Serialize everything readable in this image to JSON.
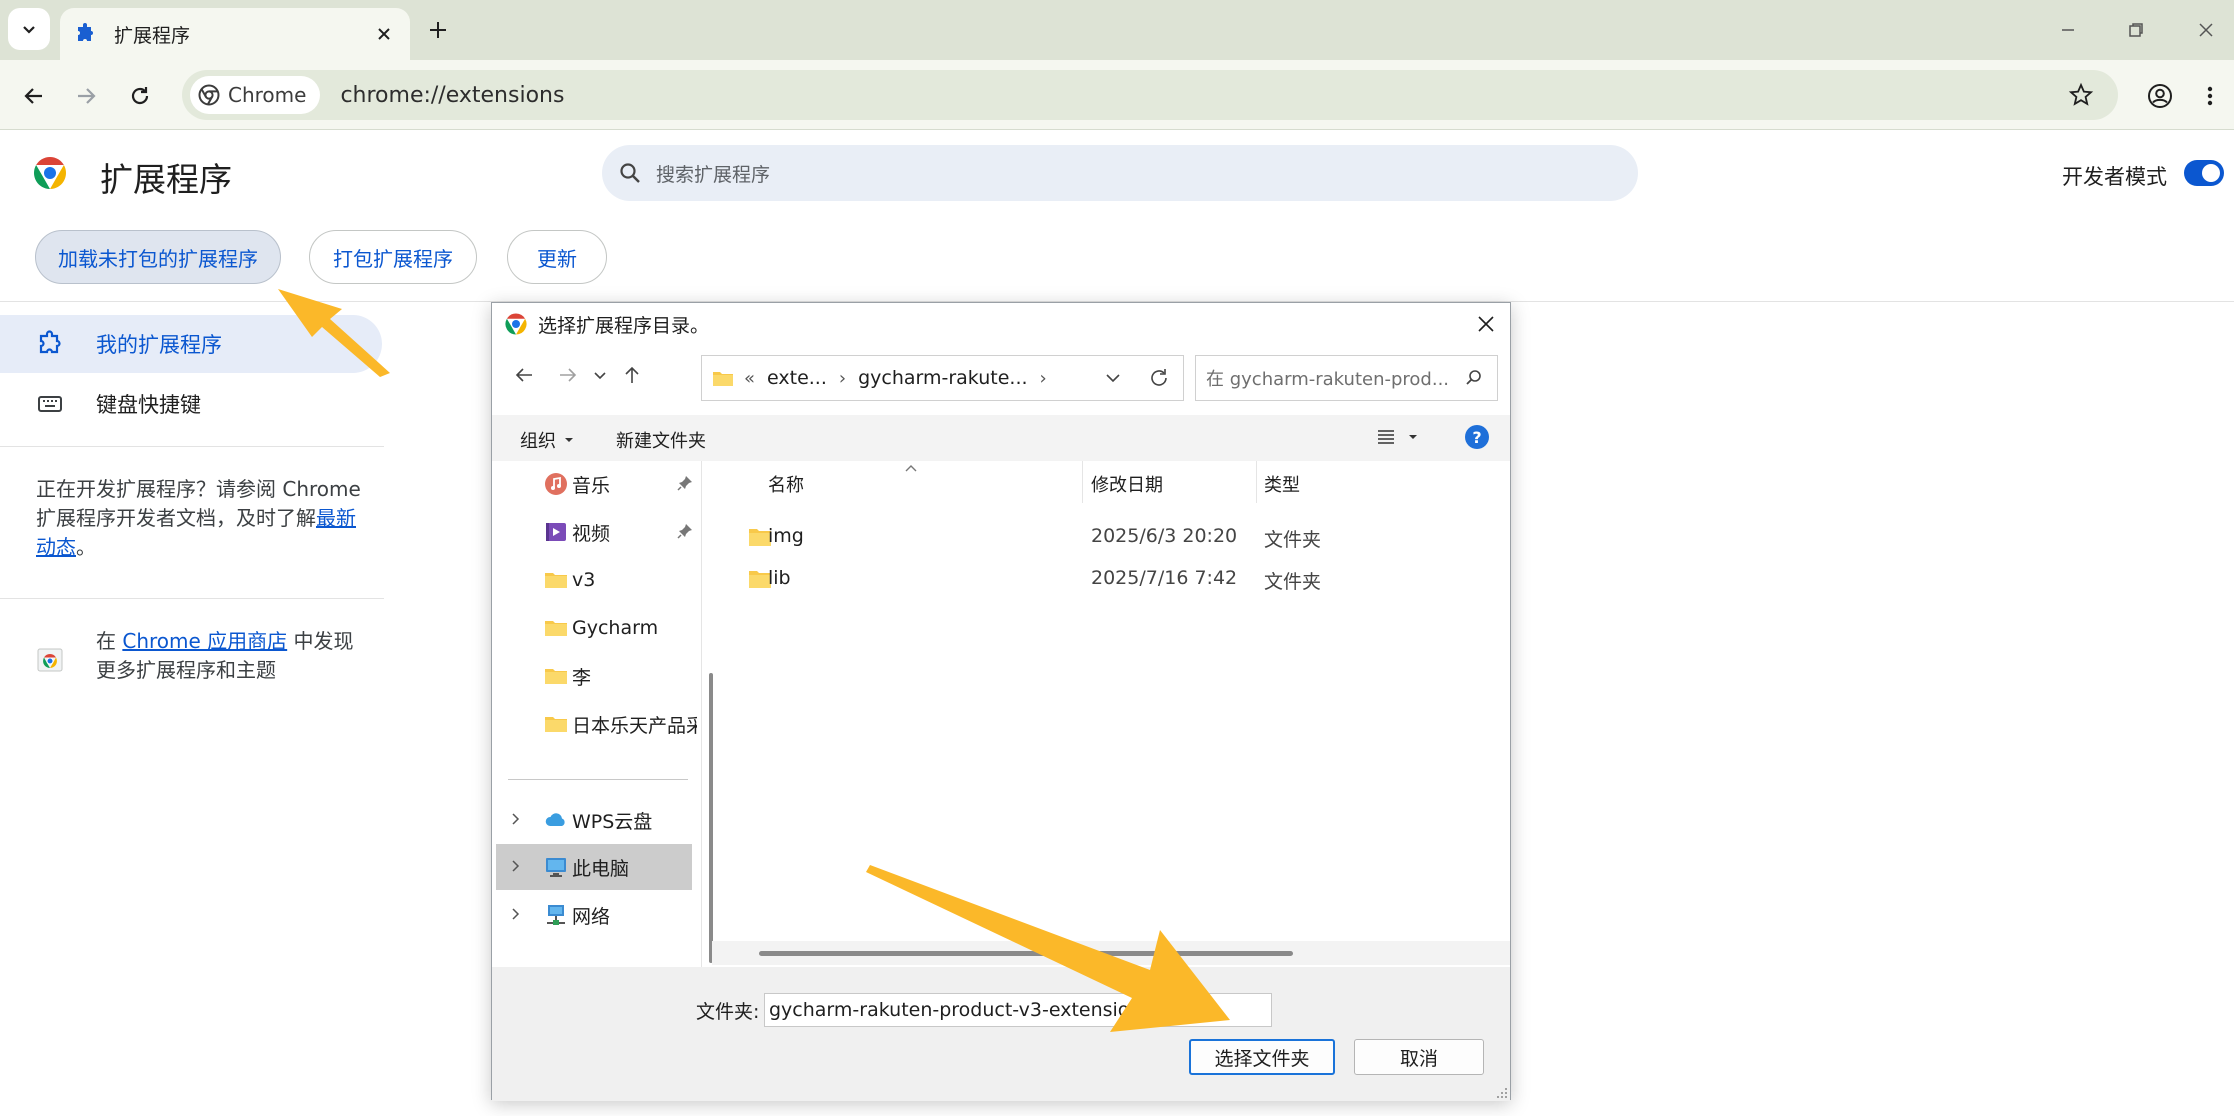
{
  "browser": {
    "tab_title": "扩展程序",
    "chip_label": "Chrome",
    "url": "chrome://extensions"
  },
  "page": {
    "title": "扩展程序",
    "search_placeholder": "搜索扩展程序",
    "dev_mode_label": "开发者模式",
    "dev_mode_on": true,
    "buttons": {
      "load_unpacked": "加载未打包的扩展程序",
      "pack": "打包扩展程序",
      "update": "更新"
    },
    "sidebar": {
      "my_extensions": "我的扩展程序",
      "shortcuts": "键盘快捷键",
      "dev_text_1": "正在开发扩展程序？请参阅 Chrome 扩展程序开发者文档，及时了解",
      "dev_link": "最新动态",
      "dev_text_2": "。",
      "store_text_1": "在",
      "store_link": "Chrome 应用商店",
      "store_text_2": "中发现更多扩展程序和主题"
    }
  },
  "dialog": {
    "title": "选择扩展程序目录。",
    "address": {
      "prefix": "«",
      "segments": [
        "exte...",
        "gycharm-rakute..."
      ]
    },
    "search_placeholder": "在 gycharm-rakuten-prod...",
    "cmd": {
      "organize": "组织",
      "new_folder": "新建文件夹"
    },
    "tree": [
      {
        "label": "音乐",
        "icon": "music-icon",
        "pinned": true
      },
      {
        "label": "视频",
        "icon": "video-icon",
        "pinned": true
      },
      {
        "label": "v3",
        "icon": "folder-icon"
      },
      {
        "label": "Gycharm",
        "icon": "folder-icon"
      },
      {
        "label": "李",
        "icon": "folder-icon"
      },
      {
        "label": "日本乐天产品采",
        "icon": "folder-icon"
      },
      {
        "label": "WPS云盘",
        "icon": "cloud-icon",
        "expandable": true
      },
      {
        "label": "此电脑",
        "icon": "computer-icon",
        "expandable": true,
        "selected": true
      },
      {
        "label": "网络",
        "icon": "network-icon",
        "expandable": true
      }
    ],
    "columns": {
      "name": "名称",
      "modified": "修改日期",
      "type": "类型"
    },
    "rows": [
      {
        "name": "img",
        "modified": "2025/6/3 20:20",
        "type": "文件夹"
      },
      {
        "name": "lib",
        "modified": "2025/7/16 7:42",
        "type": "文件夹"
      }
    ],
    "folder_label": "文件夹:",
    "folder_value": "gycharm-rakuten-product-v3-extension",
    "select_button": "选择文件夹",
    "cancel_button": "取消"
  },
  "colors": {
    "accent": "#0b57d0",
    "annotation_arrow": "#fbb829"
  }
}
